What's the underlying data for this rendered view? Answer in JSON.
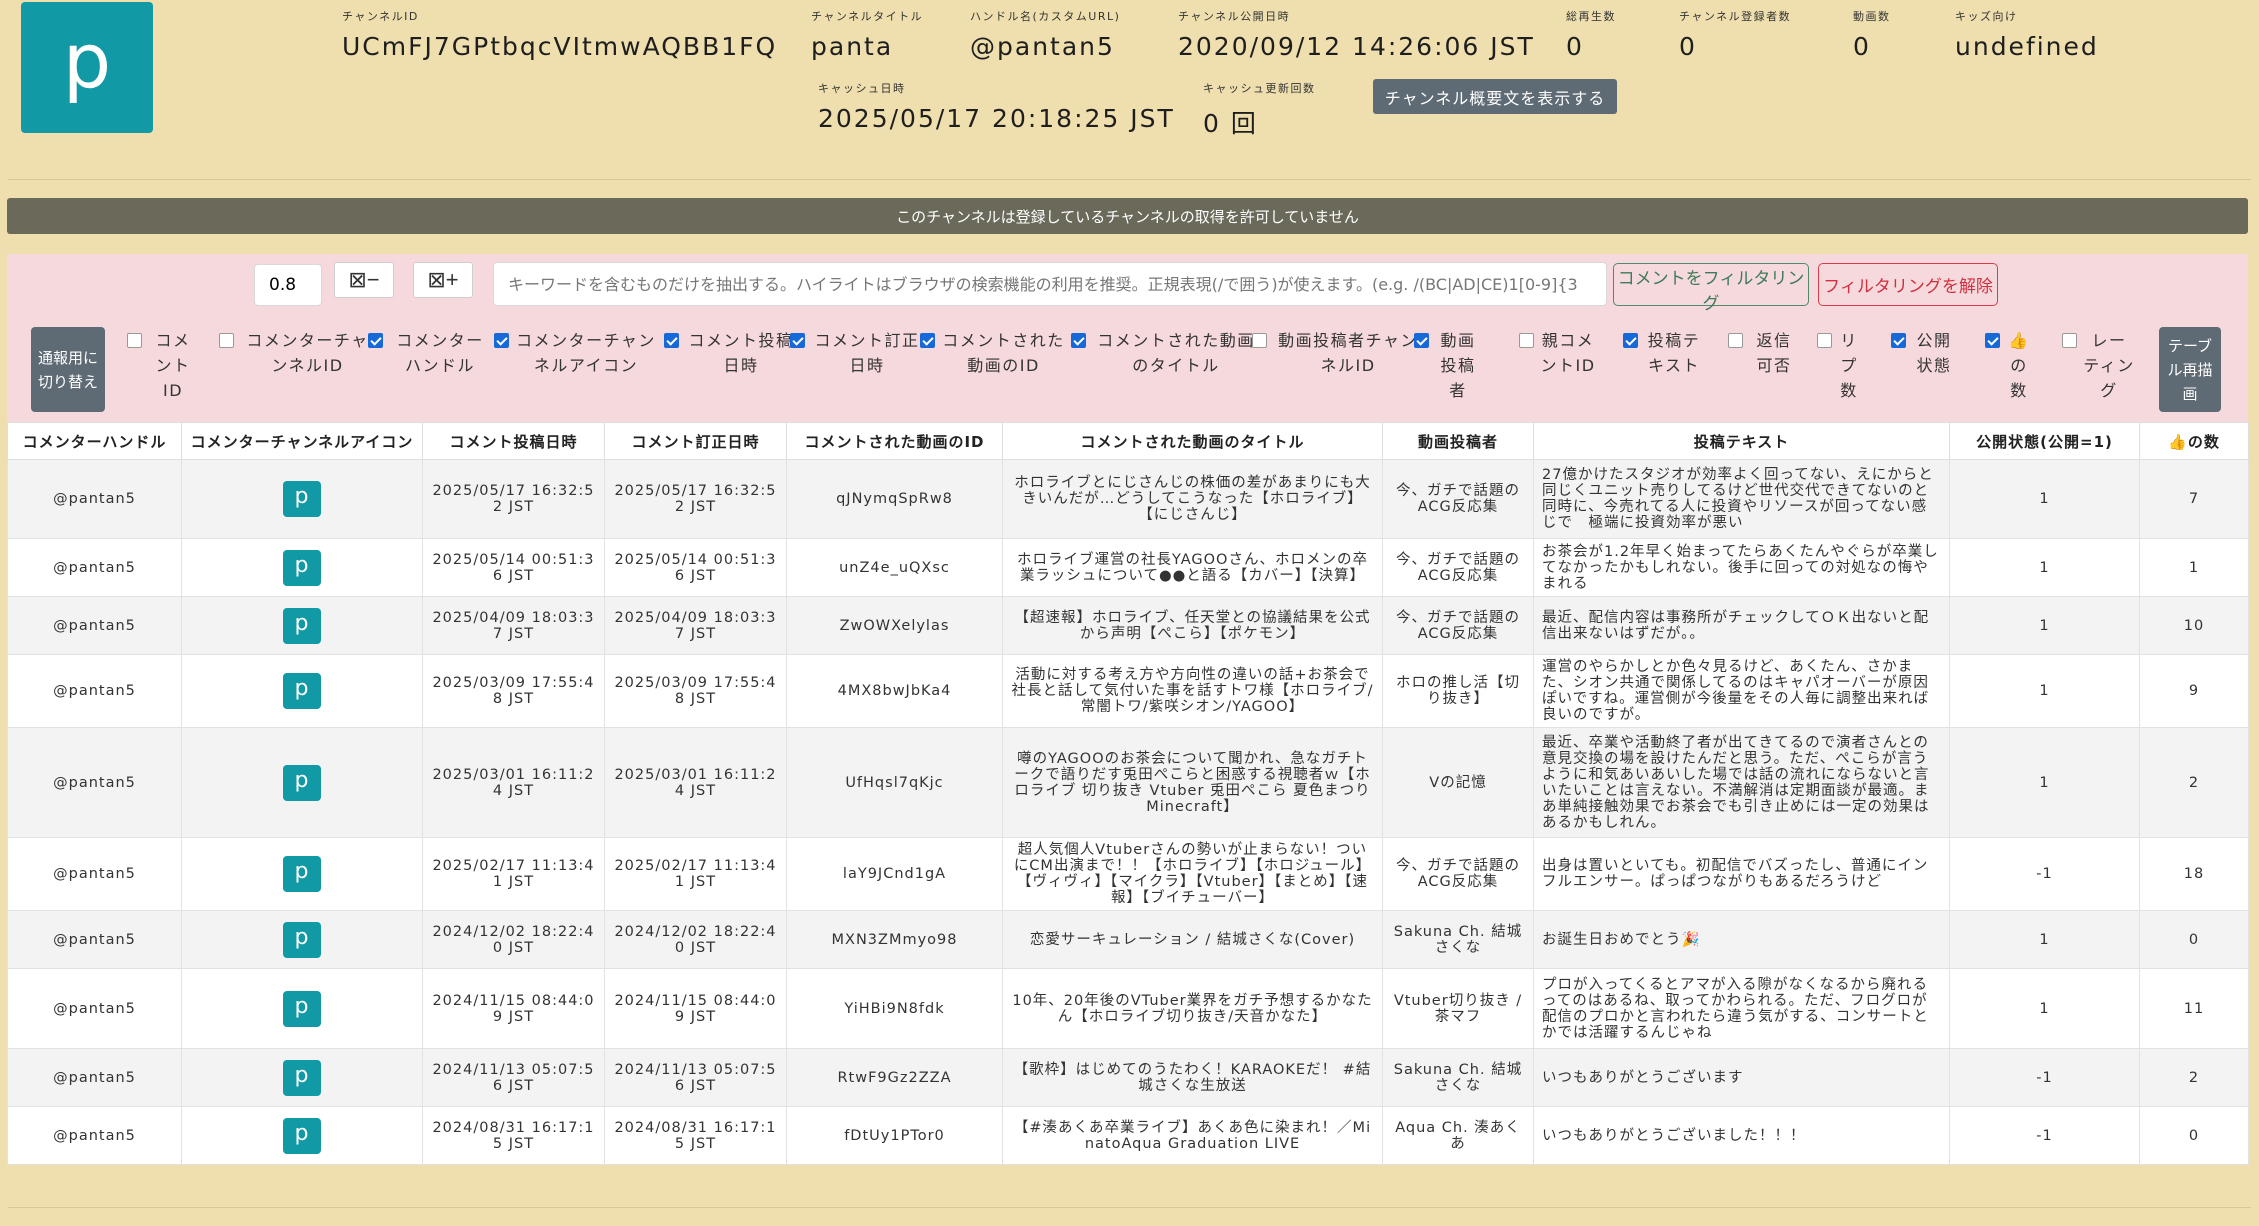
{
  "channel": {
    "avatar_letter": "p",
    "fields": [
      {
        "label": "チャンネルID",
        "value": "UCmFJ7GPtbqcVItmwAQBB1FQ"
      },
      {
        "label": "チャンネルタイトル",
        "value": "panta"
      },
      {
        "label": "ハンドル名(カスタムURL)",
        "value": "@pantan5"
      },
      {
        "label": "チャンネル公開日時",
        "value": "2020/09/12 14:26:06 JST"
      },
      {
        "label": "総再生数",
        "value": "0"
      },
      {
        "label": "チャンネル登録者数",
        "value": "0"
      },
      {
        "label": "動画数",
        "value": "0"
      },
      {
        "label": "キッズ向け",
        "value": "undefined"
      },
      {
        "label": "キャッシュ日時",
        "value": "2025/05/17 20:18:25 JST"
      },
      {
        "label": "キャッシュ更新回数",
        "value": "0 回"
      }
    ],
    "desc_button": "チャンネル概要文を表示する"
  },
  "notice": "このチャンネルは登録しているチャンネルの取得を許可していません",
  "controls": {
    "threshold_value": "0.8",
    "minus_label": "⊠−",
    "plus_label": "⊠+",
    "keyword_placeholder": "キーワードを含むものだけを抽出する。ハイライトはブラウザの検索機能の利用を推奨。正規表現(/で囲う)が使えます。(e.g. /(BC|AD|CE)1[0-9]{3",
    "filter_button": "コメントをフィルタリング",
    "clear_button": "フィルタリングを解除",
    "switch_button": "通報用に切り替え",
    "redraw_button": "テーブル再描画",
    "columns": [
      {
        "label": "コメントID",
        "checked": false
      },
      {
        "label": "コメンターチャンネルID",
        "checked": false
      },
      {
        "label": "コメンターハンドル",
        "checked": true
      },
      {
        "label": "コメンターチャンネルアイコン",
        "checked": true
      },
      {
        "label": "コメント投稿日時",
        "checked": true
      },
      {
        "label": "コメント訂正日時",
        "checked": true
      },
      {
        "label": "コメントされた動画のID",
        "checked": true
      },
      {
        "label": "コメントされた動画のタイトル",
        "checked": true
      },
      {
        "label": "動画投稿者チャンネルID",
        "checked": false
      },
      {
        "label": "動画投稿者",
        "checked": true
      },
      {
        "label": "親コメントID",
        "checked": false
      },
      {
        "label": "投稿テキスト",
        "checked": true
      },
      {
        "label": "返信可否",
        "checked": false
      },
      {
        "label": "リプ数",
        "checked": false
      },
      {
        "label": "公開状態",
        "checked": true
      },
      {
        "label": "👍の数",
        "checked": true
      },
      {
        "label": "レーティング",
        "checked": false
      }
    ]
  },
  "table": {
    "headers": [
      "コメンターハンドル",
      "コメンターチャンネルアイコン",
      "コメント投稿日時",
      "コメント訂正日時",
      "コメントされた動画のID",
      "コメントされた動画のタイトル",
      "動画投稿者",
      "投稿テキスト",
      "公開状態(公開=1)",
      "👍の数"
    ],
    "rows": [
      {
        "handle": "@pantan5",
        "icon": "p",
        "posted": "2025/05/17 16:32:52 JST",
        "edited": "2025/05/17 16:32:52 JST",
        "video_id": "qJNymqSpRw8",
        "video_title": "ホロライブとにじさんじの株価の差があまりにも大きいんだが…どうしてこうなった【ホロライブ】【にじさんじ】",
        "uploader": "今、ガチで話題のACG反応集",
        "text": "27億かけたスタジオが効率よく回ってない、えにからと同じくユニット売りしてるけど世代交代できてないのと同時に、今売れてる人に投資やリソースが回ってない感じで　極端に投資効率が悪い",
        "public": "1",
        "likes": "7"
      },
      {
        "handle": "@pantan5",
        "icon": "p",
        "posted": "2025/05/14 00:51:36 JST",
        "edited": "2025/05/14 00:51:36 JST",
        "video_id": "unZ4e_uQXsc",
        "video_title": "ホロライブ運営の社長YAGOOさん、ホロメンの卒業ラッシュについて●●と語る【カバー】【決算】",
        "uploader": "今、ガチで話題のACG反応集",
        "text": "お茶会が1.2年早く始まってたらあくたんやぐらが卒業してなかったかもしれない。後手に回っての対処なの悔やまれる",
        "public": "1",
        "likes": "1"
      },
      {
        "handle": "@pantan5",
        "icon": "p",
        "posted": "2025/04/09 18:03:37 JST",
        "edited": "2025/04/09 18:03:37 JST",
        "video_id": "ZwOWXelylas",
        "video_title": "【超速報】ホロライブ、任天堂との協議結果を公式から声明【ぺこら】【ポケモン】",
        "uploader": "今、ガチで話題のACG反応集",
        "text": "最近、配信内容は事務所がチェックしてＯＫ出ないと配信出来ないはずだが。。",
        "public": "1",
        "likes": "10"
      },
      {
        "handle": "@pantan5",
        "icon": "p",
        "posted": "2025/03/09 17:55:48 JST",
        "edited": "2025/03/09 17:55:48 JST",
        "video_id": "4MX8bwJbKa4",
        "video_title": "活動に対する考え方や方向性の違いの話+お茶会で社長と話して気付いた事を話すトワ様【ホロライブ/常闇トワ/紫咲シオン/YAGOO】",
        "uploader": "ホロの推し活【切り抜き】",
        "text": "運営のやらかしとか色々見るけど、あくたん、さかまた、シオン共通で関係してるのはキャパオーバーが原因ぽいですね。運営側が今後量をその人毎に調整出来れば良いのですが。",
        "public": "1",
        "likes": "9"
      },
      {
        "handle": "@pantan5",
        "icon": "p",
        "posted": "2025/03/01 16:11:24 JST",
        "edited": "2025/03/01 16:11:24 JST",
        "video_id": "UfHqsl7qKjc",
        "video_title": "噂のYAGOOのお茶会について聞かれ、急なガチトークで語りだす兎田ぺこらと困惑する視聴者ｗ【ホロライブ 切り抜き Vtuber 兎田ぺこら 夏色まつり Minecraft】",
        "uploader": "Vの記憶",
        "text": "最近、卒業や活動終了者が出てきてるので演者さんとの意見交換の場を設けたんだと思う。ただ、ぺこらが言うように和気あいあいした場では話の流れにならないと言いたいことは言えない。不満解消は定期面談が最適。まあ単純接触効果でお茶会でも引き止めには一定の効果はあるかもしれん。",
        "public": "1",
        "likes": "2"
      },
      {
        "handle": "@pantan5",
        "icon": "p",
        "posted": "2025/02/17 11:13:41 JST",
        "edited": "2025/02/17 11:13:41 JST",
        "video_id": "laY9JCnd1gA",
        "video_title": "超人気個人Vtuberさんの勢いが止まらない！ついにCM出演まで！！【ホロライブ】【ホロジュール】【ヴィヴィ】【マイクラ】【Vtuber】【まとめ】【速報】【ブイチューバー】",
        "uploader": "今、ガチで話題のACG反応集",
        "text": "出身は置いといても。初配信でバズったし、普通にインフルエンサー。ぱっぱつながりもあるだろうけど",
        "public": "-1",
        "likes": "18"
      },
      {
        "handle": "@pantan5",
        "icon": "p",
        "posted": "2024/12/02 18:22:40 JST",
        "edited": "2024/12/02 18:22:40 JST",
        "video_id": "MXN3ZMmyo98",
        "video_title": "恋愛サーキュレーション / 結城さくな(Cover)",
        "uploader": "Sakuna Ch. 結城さくな",
        "text": "お誕生日おめでとう🎉",
        "public": "1",
        "likes": "0"
      },
      {
        "handle": "@pantan5",
        "icon": "p",
        "posted": "2024/11/15 08:44:09 JST",
        "edited": "2024/11/15 08:44:09 JST",
        "video_id": "YiHBi9N8fdk",
        "video_title": "10年、20年後のVTuber業界をガチ予想するかなたん【ホロライブ切り抜き/天音かなた】",
        "uploader": "Vtuber切り抜き / 茶マフ",
        "text": "プロが入ってくるとアマが入る隙がなくなるから廃れるってのはあるね、取ってかわられる。ただ、フログロが配信のプロかと言われたら違う気がする、コンサートとかでは活躍するんじゃね",
        "public": "1",
        "likes": "11"
      },
      {
        "handle": "@pantan5",
        "icon": "p",
        "posted": "2024/11/13 05:07:56 JST",
        "edited": "2024/11/13 05:07:56 JST",
        "video_id": "RtwF9Gz2ZZA",
        "video_title": "【歌枠】はじめてのうたわく！KARAOKEだ！ #結城さくな生放送",
        "uploader": "Sakuna Ch. 結城さくな",
        "text": "いつもありがとうございます",
        "public": "-1",
        "likes": "2"
      },
      {
        "handle": "@pantan5",
        "icon": "p",
        "posted": "2024/08/31 16:17:15 JST",
        "edited": "2024/08/31 16:17:15 JST",
        "video_id": "fDtUy1PTor0",
        "video_title": "【#湊あくあ卒業ライブ】あくあ色に染まれ！／MinatoAqua Graduation LIVE",
        "uploader": "Aqua Ch. 湊あくあ",
        "text": "いつもありがとうございました！！！",
        "public": "-1",
        "likes": "0"
      }
    ]
  }
}
